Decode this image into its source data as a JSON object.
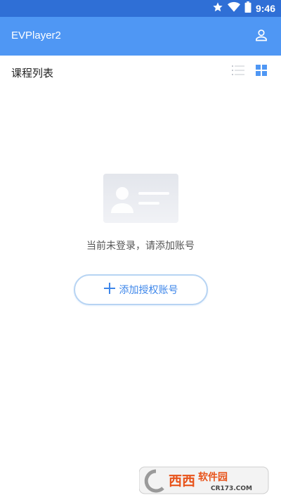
{
  "status_bar": {
    "time": "9:46"
  },
  "app_bar": {
    "title": "EVPlayer2",
    "profile_icon": "person-icon"
  },
  "section": {
    "title": "课程列表",
    "list_view_icon": "list-view-icon",
    "grid_view_icon": "grid-view-icon"
  },
  "empty_state": {
    "message": "当前未登录，请添加账号",
    "illustration_icon": "id-card-icon"
  },
  "add_account": {
    "label": "添加授权账号",
    "icon": "plus-icon"
  },
  "watermark": {
    "name": "西西软件园",
    "site": "CR173.COM"
  },
  "colors": {
    "primary": "#4f97f4",
    "status_bar": "#2f6fd6",
    "button_border": "#b7d4f3",
    "button_text": "#3d86ea"
  }
}
